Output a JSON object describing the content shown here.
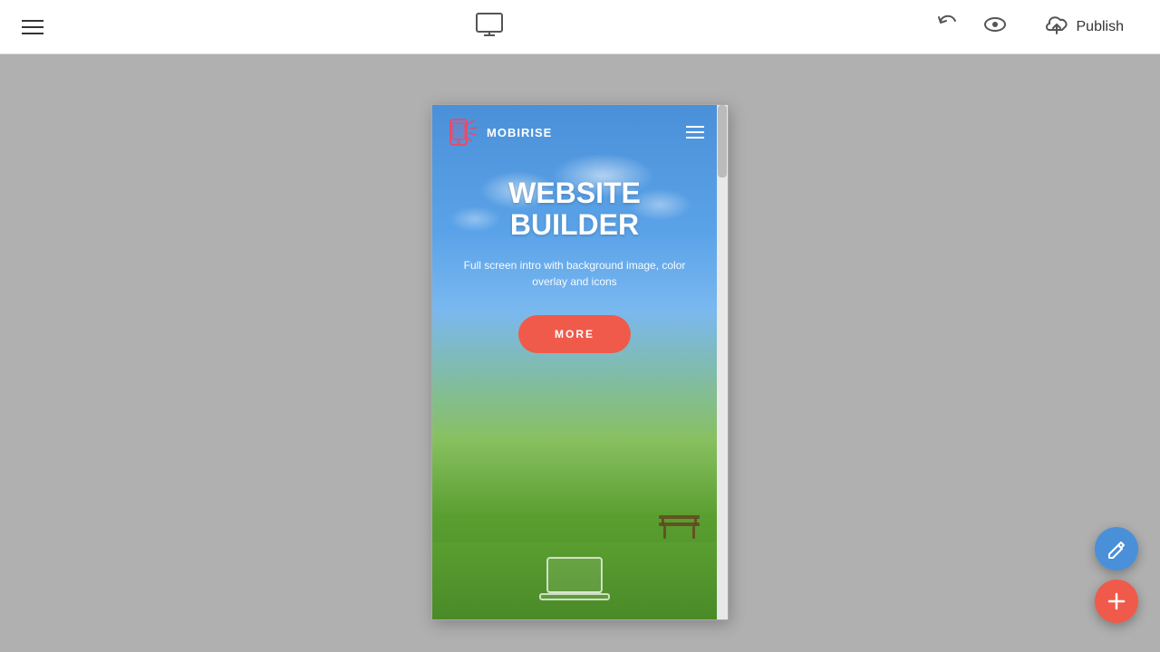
{
  "toolbar": {
    "title": "Website Builder",
    "publish_label": "Publish",
    "hamburger_aria": "menu",
    "undo_aria": "undo",
    "preview_aria": "preview",
    "publish_aria": "publish"
  },
  "preview": {
    "nav": {
      "brand_name": "MOBIRISE"
    },
    "hero": {
      "title_line1": "WEBSITE",
      "title_line2": "BUILDER",
      "subtitle": "Full screen intro with background image, color overlay and icons",
      "cta_label": "MORE"
    },
    "fab": {
      "edit_label": "edit",
      "add_label": "add"
    }
  }
}
